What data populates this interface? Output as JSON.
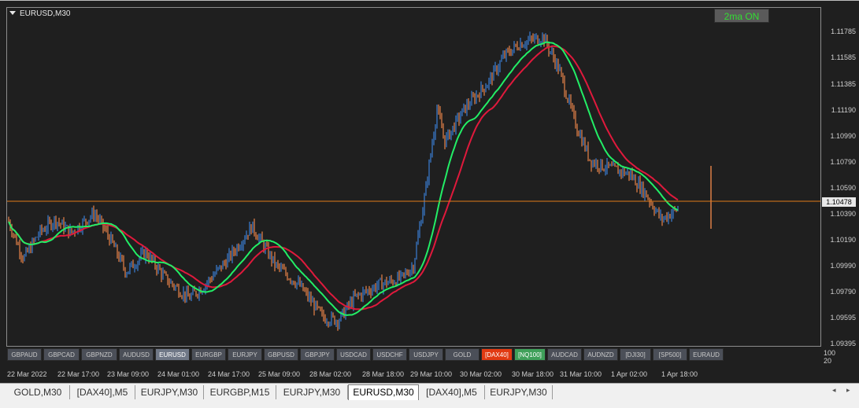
{
  "chart": {
    "symbol_title": "EURUSD,M30",
    "ma_button": "2ma ON",
    "current_price": "1.10478",
    "price_axis": [
      "1.11785",
      "1.11585",
      "1.11385",
      "1.11190",
      "1.10990",
      "1.10790",
      "1.10590",
      "1.10390",
      "1.10190",
      "1.09990",
      "1.09790",
      "1.09595",
      "1.09395"
    ],
    "sub_axis": [
      "100",
      "20"
    ],
    "time_axis": [
      "22 Mar 2022",
      "22 Mar 17:00",
      "23 Mar 09:00",
      "24 Mar 01:00",
      "24 Mar 17:00",
      "25 Mar 09:00",
      "28 Mar 02:00",
      "28 Mar 18:00",
      "29 Mar 10:00",
      "30 Mar 02:00",
      "30 Mar 18:00",
      "31 Mar 10:00",
      "1 Apr 02:00",
      "1 Apr 18:00"
    ],
    "colors": {
      "bull": "#3b7fd6",
      "bear": "#e8844a",
      "ma_fast": "#22ee66",
      "ma_slow": "#e0193c",
      "price_line": "#e07b1a",
      "background": "#1f1f1f"
    }
  },
  "pair_buttons": [
    {
      "label": "GBPAUD",
      "state": "normal"
    },
    {
      "label": "GBPCAD",
      "state": "normal"
    },
    {
      "label": "GBPNZD",
      "state": "normal"
    },
    {
      "label": "AUDUSD",
      "state": "normal"
    },
    {
      "label": "EURUSD",
      "state": "active"
    },
    {
      "label": "EURGBP",
      "state": "normal"
    },
    {
      "label": "EURJPY",
      "state": "normal"
    },
    {
      "label": "GBPUSD",
      "state": "normal"
    },
    {
      "label": "GBPJPY",
      "state": "normal"
    },
    {
      "label": "USDCAD",
      "state": "normal"
    },
    {
      "label": "USDCHF",
      "state": "normal"
    },
    {
      "label": "USDJPY",
      "state": "normal"
    },
    {
      "label": "GOLD",
      "state": "normal"
    },
    {
      "label": "[DAX40]",
      "state": "red"
    },
    {
      "label": "[NQ100]",
      "state": "green"
    },
    {
      "label": "AUDCAD",
      "state": "normal"
    },
    {
      "label": "AUDNZD",
      "state": "normal"
    },
    {
      "label": "[DJI30]",
      "state": "normal"
    },
    {
      "label": "[SP500]",
      "state": "normal"
    },
    {
      "label": "EURAUD",
      "state": "normal"
    }
  ],
  "tabs": [
    {
      "label": "GOLD,M30",
      "active": false
    },
    {
      "label": "[DAX40],M5",
      "active": false
    },
    {
      "label": "EURJPY,M30",
      "active": false
    },
    {
      "label": "EURGBP,M15",
      "active": false
    },
    {
      "label": "EURJPY,M30",
      "active": false
    },
    {
      "label": "EURUSD,M30",
      "active": true
    },
    {
      "label": "[DAX40],M5",
      "active": false
    },
    {
      "label": "EURJPY,M30",
      "active": false
    }
  ],
  "tab_nav": {
    "left": "◂",
    "right": "▸"
  }
}
